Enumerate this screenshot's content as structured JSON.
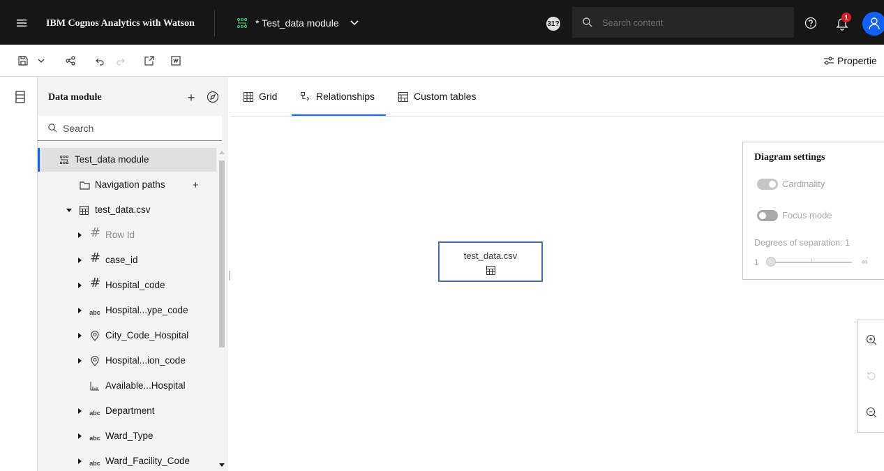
{
  "header": {
    "app_title": "IBM Cognos Analytics with Watson",
    "module_name": "* Test_data module",
    "user_count": "31?",
    "search_placeholder": "Search content",
    "notification_count": "1"
  },
  "toolbar": {
    "properties_label": "Propertie"
  },
  "panel": {
    "title": "Data module",
    "search_placeholder": "Search",
    "tree": [
      {
        "label": "Test_data module",
        "icon": "module-icon",
        "type": "root"
      },
      {
        "label": "Navigation paths",
        "icon": "folder-icon",
        "type": "folder"
      },
      {
        "label": "test_data.csv",
        "icon": "table-icon",
        "type": "table"
      },
      {
        "label": "Row Id",
        "icon": "hash-icon",
        "type": "field-dim"
      },
      {
        "label": "case_id",
        "icon": "hash-icon",
        "type": "field"
      },
      {
        "label": "Hospital_code",
        "icon": "hash-icon",
        "type": "field"
      },
      {
        "label": "Hospital...ype_code",
        "icon": "abc-icon",
        "type": "field"
      },
      {
        "label": "City_Code_Hospital",
        "icon": "location-icon",
        "type": "field"
      },
      {
        "label": "Hospital...ion_code",
        "icon": "location-icon",
        "type": "field"
      },
      {
        "label": "Available...Hospital",
        "icon": "measure-icon",
        "type": "field-leaf"
      },
      {
        "label": "Department",
        "icon": "abc-icon",
        "type": "field"
      },
      {
        "label": "Ward_Type",
        "icon": "abc-icon",
        "type": "field"
      },
      {
        "label": "Ward_Facility_Code",
        "icon": "abc-icon",
        "type": "field"
      }
    ],
    "abc_glyph": "abc",
    "hash_glyph": "#"
  },
  "tabs": [
    {
      "label": "Grid",
      "icon": "grid-icon",
      "active": false
    },
    {
      "label": "Relationships",
      "icon": "relationship-icon",
      "active": true
    },
    {
      "label": "Custom tables",
      "icon": "custom-table-icon",
      "active": false
    }
  ],
  "canvas": {
    "table_node_label": "test_data.csv"
  },
  "diagram_settings": {
    "title": "Diagram settings",
    "cardinality_label": "Cardinality",
    "cardinality_on": true,
    "focus_mode_label": "Focus mode",
    "focus_mode_on": false,
    "degrees_label": "Degrees of separation: 1",
    "slider_min": "1",
    "slider_max": "∞",
    "slider_value": 1
  },
  "colors": {
    "header_bg": "#161616",
    "accent": "#0f62fe",
    "panel_bg": "#f4f4f4",
    "node_border": "#4a70b4",
    "badge_red": "#da1e28"
  }
}
